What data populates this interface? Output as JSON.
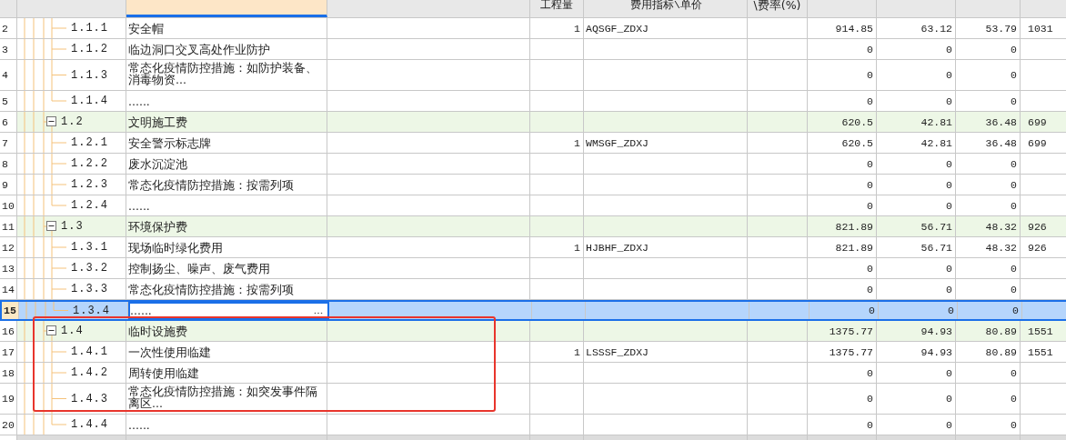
{
  "header": {
    "quantity": "工程量",
    "price_index": "费用指标\\单价",
    "rate": "\\费率(%)"
  },
  "tree": [
    {
      "children": [
        {
          "row_number": "2",
          "code": "1.1.1",
          "name": "安全帽",
          "quantity": "1",
          "price_index": "AQSGF_ZDXJ",
          "values": [
            "914.85",
            "63.12",
            "53.79",
            "1031"
          ],
          "selected": false
        },
        {
          "row_number": "3",
          "code": "1.1.2",
          "name": "临边洞口交叉高处作业防护",
          "values": [
            "0",
            "0",
            "0"
          ],
          "selected": false
        },
        {
          "row_number": "4",
          "code": "1.1.3",
          "name": "常态化疫情防控措施：如防护装备、消毒物资...",
          "values": [
            "0",
            "0",
            "0"
          ],
          "selected": false
        },
        {
          "row_number": "5",
          "code": "1.1.4",
          "name": "......",
          "values": [
            "0",
            "0",
            "0"
          ],
          "selected": false
        }
      ]
    },
    {
      "row_number": "6",
      "code": "1.2",
      "name": "文明施工费",
      "values": [
        "620.5",
        "42.81",
        "36.48",
        "699"
      ],
      "selected": false,
      "expanded": true,
      "children": [
        {
          "row_number": "7",
          "code": "1.2.1",
          "name": "安全警示标志牌",
          "quantity": "1",
          "price_index": "WMSGF_ZDXJ",
          "values": [
            "620.5",
            "42.81",
            "36.48",
            "699"
          ],
          "selected": false
        },
        {
          "row_number": "8",
          "code": "1.2.2",
          "name": "废水沉淀池",
          "values": [
            "0",
            "0",
            "0"
          ],
          "selected": false
        },
        {
          "row_number": "9",
          "code": "1.2.3",
          "name": "常态化疫情防控措施：按需列项",
          "values": [
            "0",
            "0",
            "0"
          ],
          "selected": false
        },
        {
          "row_number": "10",
          "code": "1.2.4",
          "name": "......",
          "values": [
            "0",
            "0",
            "0"
          ],
          "selected": false
        }
      ]
    },
    {
      "row_number": "11",
      "code": "1.3",
      "name": "环境保护费",
      "values": [
        "821.89",
        "56.71",
        "48.32",
        "926"
      ],
      "selected": false,
      "expanded": true,
      "children": [
        {
          "row_number": "12",
          "code": "1.3.1",
          "name": "现场临时绿化费用",
          "quantity": "1",
          "price_index": "HJBHF_ZDXJ",
          "values": [
            "821.89",
            "56.71",
            "48.32",
            "926"
          ],
          "selected": false
        },
        {
          "row_number": "13",
          "code": "1.3.2",
          "name": "控制扬尘、噪声、废气费用",
          "values": [
            "0",
            "0",
            "0"
          ],
          "selected": false
        },
        {
          "row_number": "14",
          "code": "1.3.3",
          "name": "常态化疫情防控措施：按需列项",
          "values": [
            "0",
            "0",
            "0"
          ],
          "selected": false
        },
        {
          "row_number": "15",
          "code": "1.3.4",
          "name": "......",
          "values": [
            "0",
            "0",
            "0"
          ],
          "selected": true
        }
      ]
    },
    {
      "row_number": "16",
      "code": "1.4",
      "name": "临时设施费",
      "values": [
        "1375.77",
        "94.93",
        "80.89",
        "1551"
      ],
      "selected": false,
      "expanded": true,
      "children": [
        {
          "row_number": "17",
          "code": "1.4.1",
          "name": "一次性使用临建",
          "quantity": "1",
          "price_index": "LSSSF_ZDXJ",
          "values": [
            "1375.77",
            "94.93",
            "80.89",
            "1551"
          ],
          "selected": false
        },
        {
          "row_number": "18",
          "code": "1.4.2",
          "name": "周转使用临建",
          "values": [
            "0",
            "0",
            "0"
          ],
          "selected": false
        },
        {
          "row_number": "19",
          "code": "1.4.3",
          "name": "常态化疫情防控措施：如突发事件隔离区...",
          "values": [
            "0",
            "0",
            "0"
          ],
          "selected": false
        },
        {
          "row_number": "20",
          "code": "1.4.4",
          "name": "......",
          "values": [
            "0",
            "0",
            "0"
          ],
          "selected": false
        }
      ]
    }
  ]
}
